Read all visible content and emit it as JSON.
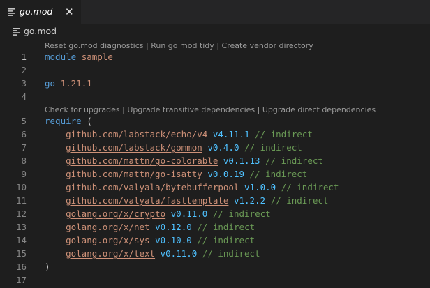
{
  "tab": {
    "title": "go.mod",
    "close_glyph": "✕",
    "icon": "file-lines-icon"
  },
  "breadcrumb": {
    "file": "go.mod"
  },
  "codelens": {
    "top": [
      "Reset go.mod diagnostics",
      "Run go mod tidy",
      "Create vendor directory"
    ],
    "require": [
      "Check for upgrades",
      "Upgrade transitive dependencies",
      "Upgrade direct dependencies"
    ],
    "separator": "|"
  },
  "lines": {
    "l1": {
      "num": "1",
      "kw": "module",
      "name": "sample"
    },
    "l2": {
      "num": "2"
    },
    "l3": {
      "num": "3",
      "kw": "go",
      "version": "1.21.1"
    },
    "l4": {
      "num": "4"
    },
    "l5": {
      "num": "5",
      "kw": "require",
      "paren": "("
    },
    "l16": {
      "num": "16",
      "paren": ")"
    },
    "l17": {
      "num": "17"
    }
  },
  "requires": [
    {
      "num": "6",
      "module": "github.com/labstack/echo/v4",
      "version": "v4.11.1",
      "comment": "// indirect"
    },
    {
      "num": "7",
      "module": "github.com/labstack/gommon",
      "version": "v0.4.0",
      "comment": "// indirect"
    },
    {
      "num": "8",
      "module": "github.com/mattn/go-colorable",
      "version": "v0.1.13",
      "comment": "// indirect"
    },
    {
      "num": "9",
      "module": "github.com/mattn/go-isatty",
      "version": "v0.0.19",
      "comment": "// indirect"
    },
    {
      "num": "10",
      "module": "github.com/valyala/bytebufferpool",
      "version": "v1.0.0",
      "comment": "// indirect"
    },
    {
      "num": "11",
      "module": "github.com/valyala/fasttemplate",
      "version": "v1.2.2",
      "comment": "// indirect"
    },
    {
      "num": "12",
      "module": "golang.org/x/crypto",
      "version": "v0.11.0",
      "comment": "// indirect"
    },
    {
      "num": "13",
      "module": "golang.org/x/net",
      "version": "v0.12.0",
      "comment": "// indirect"
    },
    {
      "num": "14",
      "module": "golang.org/x/sys",
      "version": "v0.10.0",
      "comment": "// indirect"
    },
    {
      "num": "15",
      "module": "golang.org/x/text",
      "version": "v0.11.0",
      "comment": "// indirect"
    }
  ],
  "colors": {
    "background": "#1e1e1e",
    "keyword": "#569cd6",
    "string": "#ce9178",
    "version": "#4fc1ff",
    "comment": "#6a9955",
    "line_number": "#858585"
  }
}
